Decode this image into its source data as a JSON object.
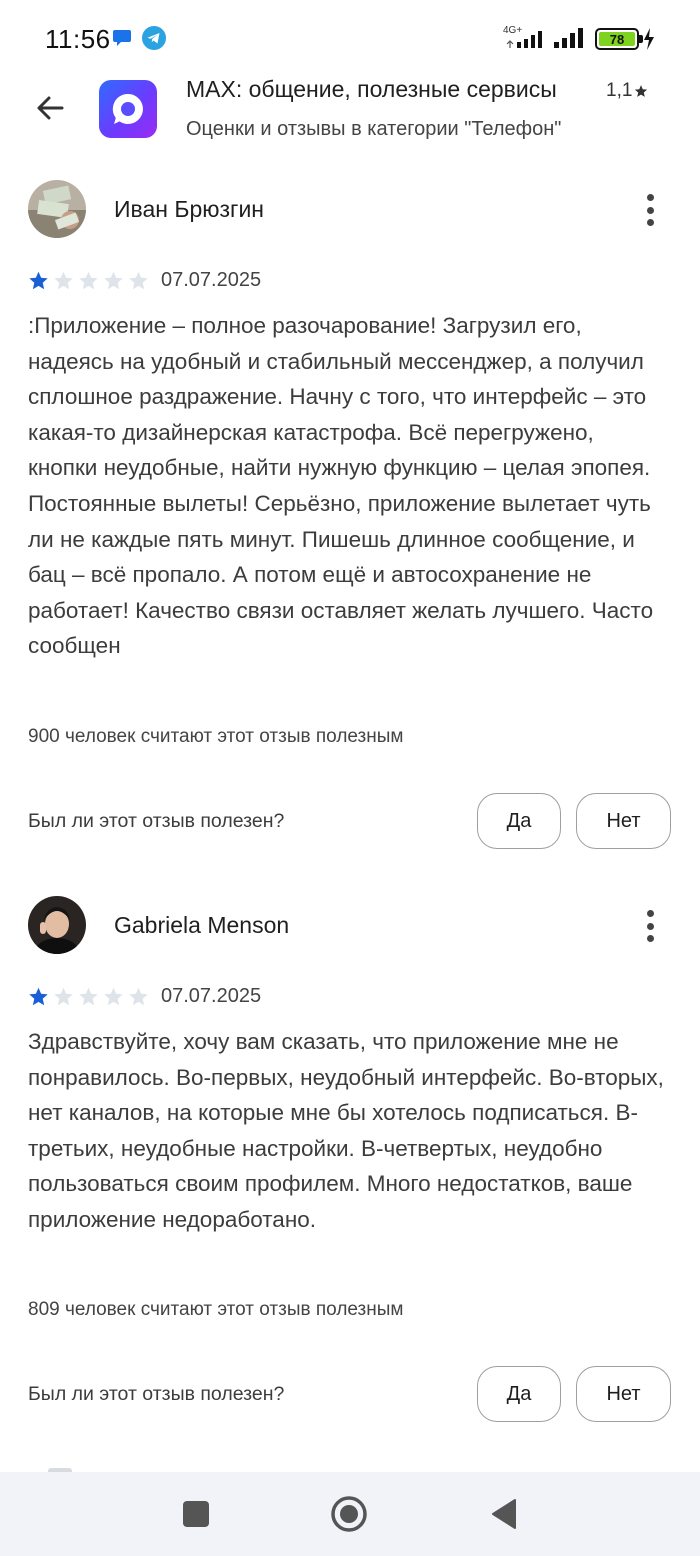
{
  "status_bar": {
    "time": "11:56",
    "network_label": "4G+",
    "battery_level": "78"
  },
  "header": {
    "back_icon": "arrow-left-icon",
    "app_title": "MAX: общение, полезные сервисы",
    "app_rating": "1,1",
    "subtitle": "Оценки и отзывы в категории \"Телефон\""
  },
  "reviews": [
    {
      "author": "Иван Брюзгин",
      "rating": 1,
      "date": "07.07.2025",
      "text": ":Приложение – полное разочарование! Загрузил его, надеясь на удобный и стабильный мессенджер, а получил сплошное раздражение. Начну с того, что интерфейс – это какая-то дизайнерская катастрофа. Всё перегружено, кнопки неудобные, найти нужную функцию – целая эпопея. Постоянные вылеты! Серьёзно, приложение вылетает чуть ли не каждые пять минут. Пишешь длинное сообщение, и бац – всё пропало. А потом ещё и автосохранение не работает! Качество связи оставляет желать лучшего. Часто сообщен",
      "helpful_count": "900 человек считают этот отзыв полезным",
      "helpful_question": "Был ли этот отзыв полезен?",
      "yes_label": "Да",
      "no_label": "Нет"
    },
    {
      "author": "Gabriela Menson",
      "rating": 1,
      "date": "07.07.2025",
      "text": "Здравствуйте, хочу вам сказать, что приложение мне не понравилось. Во-первых, неудобный интерфейс. Во-вторых, нет каналов, на которые мне бы хотелось подписаться. В-третьих, неудобные настройки. В-четвертых, неудобно пользоваться своим профилем. Много недостатков, ваше приложение недоработано.",
      "helpful_count": "809 человек считают этот отзыв полезным",
      "helpful_question": "Был ли этот отзыв полезен?",
      "yes_label": "Да",
      "no_label": "Нет"
    }
  ],
  "colors": {
    "star_filled": "#1a5fd6",
    "star_empty": "#dfe3ea",
    "nav_bg": "#f1f3f9"
  }
}
